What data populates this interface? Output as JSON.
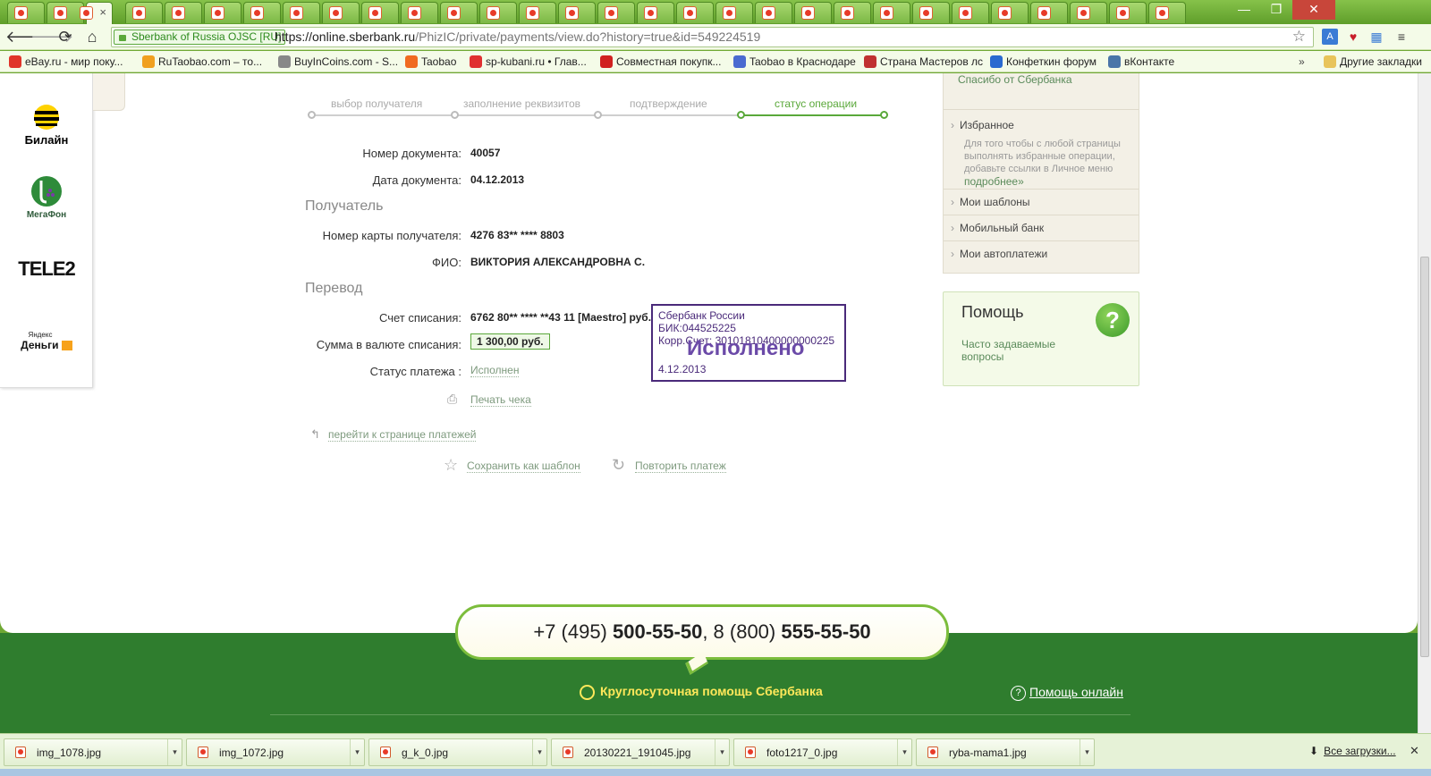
{
  "browser": {
    "tab_close": "×",
    "window_controls": {
      "minimize": "—",
      "maximize": "❐",
      "close": "✕"
    },
    "ev_badge": "Sberbank of Russia OJSC [RU]",
    "url_host": "https://online.sberbank.ru",
    "url_path": "/PhizIC/private/payments/view.do?history=true&id=549224519",
    "nav": {
      "back": "🡐",
      "forward": "🡒",
      "reload": "⟳",
      "home": "⌂"
    }
  },
  "bookmarks": [
    {
      "label": "eBay.ru - мир поку...",
      "color": "#e0342a"
    },
    {
      "label": "RuTaobao.com – то...",
      "color": "#f0a020"
    },
    {
      "label": "BuyInCoins.com - S...",
      "color": "#888888"
    },
    {
      "label": "Taobao",
      "color": "#f06a20"
    },
    {
      "label": "sp-kubani.ru • Глав...",
      "color": "#e03030"
    },
    {
      "label": "Совместная покупк...",
      "color": "#d02020"
    },
    {
      "label": "Taobao в Краснодаре",
      "color": "#4a6ad0"
    },
    {
      "label": "Страна Мастеров лс",
      "color": "#c03030"
    },
    {
      "label": "Конфеткин форум",
      "color": "#2a6ad0"
    },
    {
      "label": "вКонтакте",
      "color": "#4a76a8"
    }
  ],
  "bookmarks_more": "»",
  "other_bookmarks": "Другие закладки",
  "operators": {
    "beeline": "Билайн",
    "megafon": "МегаФон",
    "tele2": "TELE2",
    "yandex_small": "Яндекс",
    "yandex": "Деньги"
  },
  "steps": [
    {
      "label": "выбор получателя"
    },
    {
      "label": "заполнение реквизитов"
    },
    {
      "label": "подтверждение"
    },
    {
      "label": "статус операции"
    }
  ],
  "step_color_active": "#5aa83a",
  "doc": {
    "number_label": "Номер документа:",
    "number": "40057",
    "date_label": "Дата документа:",
    "date": "04.12.2013",
    "recipient_section": "Получатель",
    "card_label": "Номер карты получателя:",
    "card": "4276 83** **** 8803",
    "fio_label": "ФИО:",
    "fio": "ВИКТОРИЯ АЛЕКСАНДРОВНА С.",
    "transfer_section": "Перевод",
    "account_label": "Счет списания:",
    "account": "6762 80** **** **43 11  [Maestro]  руб.",
    "sum_label": "Сумма в валюте списания:",
    "sum": "1 300,00  руб.",
    "status_label": "Статус платежа :",
    "status": "Исполнен",
    "print": "Печать чека",
    "back_link": "перейти к странице платежей",
    "save_template": "Сохранить как шаблон",
    "repeat": "Повторить платеж"
  },
  "stamp": {
    "bank": "Сбербанк России",
    "bik": "БИК:044525225",
    "korr": "Корр.Счет: 30101810400000000225",
    "done": "Исполнено",
    "date": "4.12.2013"
  },
  "right_panel": {
    "thanks": "Спасибо от Сбербанка",
    "favorites": "Избранное",
    "favorites_desc": "Для того чтобы с любой страницы выполнять избранные операции, добавьте ссылки в Личное меню",
    "more": "подробнее»",
    "templates": "Мои шаблоны",
    "mobile": "Мобильный банк",
    "autopay": "Мои автоплатежи"
  },
  "help": {
    "title": "Помощь",
    "faq": "Часто задаваемые вопросы",
    "icon": "?"
  },
  "footer": {
    "phone1_prefix": "+7 (495) ",
    "phone1_main": "500-55-50",
    "sep": ", 8 (800) ",
    "phone2_main": "555-55-50",
    "hotline": "Круглосуточная помощь Сбербанка",
    "online_help": "Помощь онлайн"
  },
  "downloads": [
    {
      "name": "img_1078.jpg"
    },
    {
      "name": "img_1072.jpg"
    },
    {
      "name": "g_k_0.jpg"
    },
    {
      "name": "20130221_191045.jpg"
    },
    {
      "name": "foto1217_0.jpg"
    },
    {
      "name": "ryba-mama1.jpg"
    }
  ],
  "all_downloads": "Все загрузки...",
  "downloads_close": "✕",
  "caret": "▾"
}
